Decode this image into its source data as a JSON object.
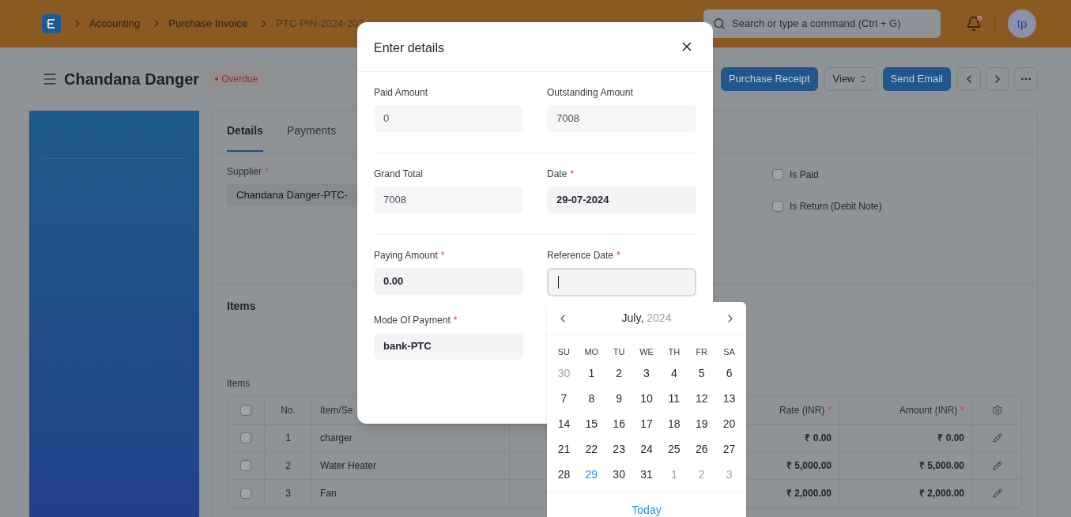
{
  "breadcrumbs": [
    "Accounting",
    "Purchase Invoice",
    "PTC-PIN-2024-202"
  ],
  "search": {
    "placeholder": "Search or type a command (Ctrl + G)"
  },
  "notifications": {
    "unread": true
  },
  "avatar": {
    "initials": "tp"
  },
  "page": {
    "title": "Chandana Danger",
    "status": "Overdue",
    "actions": [
      {
        "label": "Purchase Receipt",
        "kind": "primary"
      },
      {
        "label": "View",
        "kind": "select"
      },
      {
        "label": "Send Email",
        "kind": "primary"
      }
    ]
  },
  "tabs": [
    {
      "label": "Details",
      "selected": true
    },
    {
      "label": "Payments",
      "selected": false
    }
  ],
  "supplier": {
    "label": "Supplier",
    "marker": "*",
    "value": "Chandana Danger-PTC-"
  },
  "checkboxes": [
    {
      "label": "Is Paid",
      "checked": false
    },
    {
      "label": "Is Return (Debit Note)",
      "checked": false
    }
  ],
  "items_section": {
    "heading": "Items",
    "table_label": "Items",
    "select_all_checked": false,
    "columns": [
      {
        "label": "No."
      },
      {
        "label": "Item/Se"
      },
      {
        "label": "Rate (INR)",
        "marker": "*"
      },
      {
        "label": "Amount (INR)",
        "marker": "*"
      }
    ],
    "rows": [
      {
        "checked": false,
        "no": "1",
        "item": "charger",
        "rate": "₹ 0.00",
        "amount": "₹ 0.00"
      },
      {
        "checked": false,
        "no": "2",
        "item": "Water Heater",
        "rate": "₹ 5,000.00",
        "amount": "₹ 5,000.00"
      },
      {
        "checked": false,
        "no": "3",
        "item": "Fan",
        "rate": "₹ 2,000.00",
        "amount": "₹ 2,000.00"
      }
    ]
  },
  "dialog": {
    "title": "Enter details",
    "sections": [
      [
        {
          "label": "Paid Amount",
          "value": "0",
          "kind": "readonly"
        },
        {
          "label": "Outstanding Amount",
          "value": "7008",
          "kind": "readonly"
        }
      ],
      [
        {
          "label": "Grand Total",
          "value": "7008",
          "kind": "readonly"
        },
        {
          "label": "Date",
          "marker": "*",
          "value": "29-07-2024",
          "kind": "input"
        }
      ],
      [
        {
          "label": "Paying Amount",
          "marker": "*",
          "value": "0.00",
          "kind": "input"
        },
        {
          "label": "Reference Date",
          "marker": "*",
          "kind": "focused"
        },
        {
          "label": "Mode Of Payment",
          "marker": "*",
          "value": "bank-PTC",
          "kind": "input"
        }
      ]
    ]
  },
  "calendar": {
    "month": "July,",
    "year": "2024",
    "weekdays": [
      "SU",
      "MO",
      "TU",
      "WE",
      "TH",
      "FR",
      "SA"
    ],
    "weeks": [
      [
        {
          "day": "30",
          "kind": "other"
        },
        {
          "day": "1",
          "kind": "current"
        },
        {
          "day": "2",
          "kind": "current"
        },
        {
          "day": "3",
          "kind": "current"
        },
        {
          "day": "4",
          "kind": "current"
        },
        {
          "day": "5",
          "kind": "current"
        },
        {
          "day": "6",
          "kind": "current"
        }
      ],
      [
        {
          "day": "7",
          "kind": "current"
        },
        {
          "day": "8",
          "kind": "current"
        },
        {
          "day": "9",
          "kind": "current"
        },
        {
          "day": "10",
          "kind": "current"
        },
        {
          "day": "11",
          "kind": "current"
        },
        {
          "day": "12",
          "kind": "current"
        },
        {
          "day": "13",
          "kind": "current"
        }
      ],
      [
        {
          "day": "14",
          "kind": "current"
        },
        {
          "day": "15",
          "kind": "current"
        },
        {
          "day": "16",
          "kind": "current"
        },
        {
          "day": "17",
          "kind": "current"
        },
        {
          "day": "18",
          "kind": "current"
        },
        {
          "day": "19",
          "kind": "current"
        },
        {
          "day": "20",
          "kind": "current"
        }
      ],
      [
        {
          "day": "21",
          "kind": "current"
        },
        {
          "day": "22",
          "kind": "current"
        },
        {
          "day": "23",
          "kind": "current"
        },
        {
          "day": "24",
          "kind": "current"
        },
        {
          "day": "25",
          "kind": "current"
        },
        {
          "day": "26",
          "kind": "current"
        },
        {
          "day": "27",
          "kind": "current"
        }
      ],
      [
        {
          "day": "28",
          "kind": "current"
        },
        {
          "day": "29",
          "kind": "today"
        },
        {
          "day": "30",
          "kind": "current"
        },
        {
          "day": "31",
          "kind": "current"
        },
        {
          "day": "1",
          "kind": "other"
        },
        {
          "day": "2",
          "kind": "other"
        },
        {
          "day": "3",
          "kind": "other"
        }
      ]
    ],
    "today_button": "Today"
  }
}
